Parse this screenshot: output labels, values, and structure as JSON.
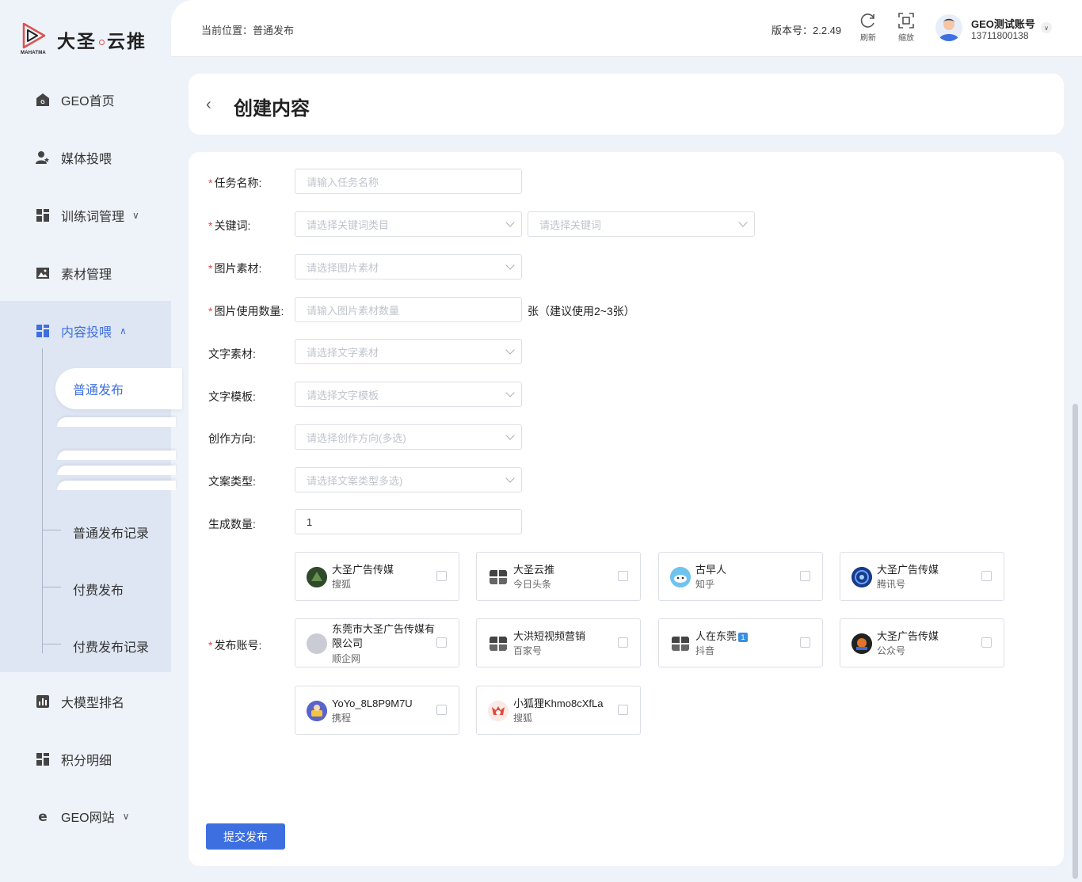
{
  "brand": {
    "name": "大圣",
    "name2": "云推",
    "sub": "MAHATMA"
  },
  "nav": {
    "items": [
      {
        "label": "GEO首页",
        "icon": "home-icon"
      },
      {
        "label": "媒体投喂",
        "icon": "user-star-icon"
      },
      {
        "label": "训练词管理",
        "icon": "grid-icon"
      },
      {
        "label": "素材管理",
        "icon": "image-icon"
      },
      {
        "label": "内容投喂",
        "icon": "grid-icon"
      },
      {
        "label": "大模型排名",
        "icon": "bar-chart-icon"
      },
      {
        "label": "积分明细",
        "icon": "grid-icon"
      },
      {
        "label": "GEO网站",
        "icon": "ie-icon"
      }
    ],
    "sub": [
      "普通发布",
      "普通发布记录",
      "付费发布",
      "付费发布记录"
    ]
  },
  "header": {
    "breadcrumb": "当前位置：普通发布",
    "version": "版本号：2.2.49",
    "refresh": "刷新",
    "zoom": "缩放",
    "user_name": "GEO测试账号",
    "user_phone": "13711800138"
  },
  "page": {
    "title": "创建内容"
  },
  "form": {
    "task_name": {
      "label": "任务名称:",
      "placeholder": "请输入任务名称"
    },
    "keyword": {
      "label": "关键词:",
      "placeholder1": "请选择关键词类目",
      "placeholder2": "请选择关键词"
    },
    "image": {
      "label": "图片素材:",
      "placeholder": "请选择图片素材"
    },
    "image_count": {
      "label": "图片使用数量:",
      "placeholder": "请输入图片素材数量",
      "hint": "张（建议使用2~3张）"
    },
    "text_material": {
      "label": "文字素材:",
      "placeholder": "请选择文字素材"
    },
    "text_template": {
      "label": "文字模板:",
      "placeholder": "请选择文字模板"
    },
    "direction": {
      "label": "创作方向:",
      "placeholder": "请选择创作方向(多选)"
    },
    "copy_type": {
      "label": "文案类型:",
      "placeholder": "请选择文案类型多选)"
    },
    "gen_count": {
      "label": "生成数量:",
      "value": "1"
    },
    "accounts_label": "发布账号:",
    "accounts": [
      {
        "name": "大圣广告传媒",
        "platform": "搜狐"
      },
      {
        "name": "大圣云推",
        "platform": "今日头条"
      },
      {
        "name": "古早人",
        "platform": "知乎"
      },
      {
        "name": "大圣广告传媒",
        "platform": "腾讯号"
      },
      {
        "name": "东莞市大圣广告传媒有限公司",
        "platform": "顺企网"
      },
      {
        "name": "大洪短视频营销",
        "platform": "百家号"
      },
      {
        "name": "人在东莞",
        "badge": "1",
        "platform": "抖音"
      },
      {
        "name": "大圣广告传媒",
        "platform": "公众号"
      },
      {
        "name": "YoYo_8L8P9M7U",
        "platform": "携程"
      },
      {
        "name": "小狐狸Khmo8cXfLa",
        "platform": "搜狐"
      }
    ],
    "submit": "提交发布"
  }
}
